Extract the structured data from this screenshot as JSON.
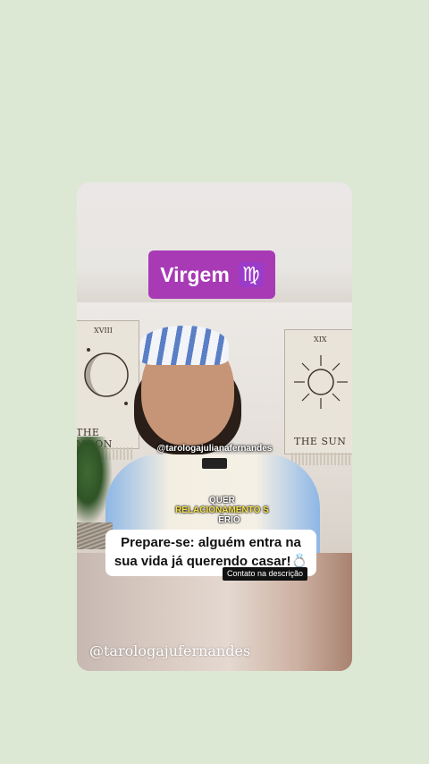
{
  "post": {
    "sign_label": "Virgem",
    "sign_icon": "♍",
    "video": {
      "tapestry_left_number": "XVIII",
      "tapestry_left_title": "THE MOON",
      "tapestry_right_number": "XIX",
      "tapestry_right_title": "THE SUN",
      "handle_overlay": "@tarologajulianafernandes",
      "caption_line1": "QUER",
      "caption_line2": "RELACIONAMENTO S",
      "caption_line3": "ÉRIO"
    },
    "headline_line1": "Prepare-se: alguém entra na",
    "headline_line2": "sua vida já querendo casar!💍",
    "contact_tag": "Contato na descrição",
    "watermark": "@tarologajufernandes"
  },
  "colors": {
    "background": "#dde8d4",
    "sign_pill": "#a83ab6",
    "caption_highlight": "#f4e04a"
  }
}
